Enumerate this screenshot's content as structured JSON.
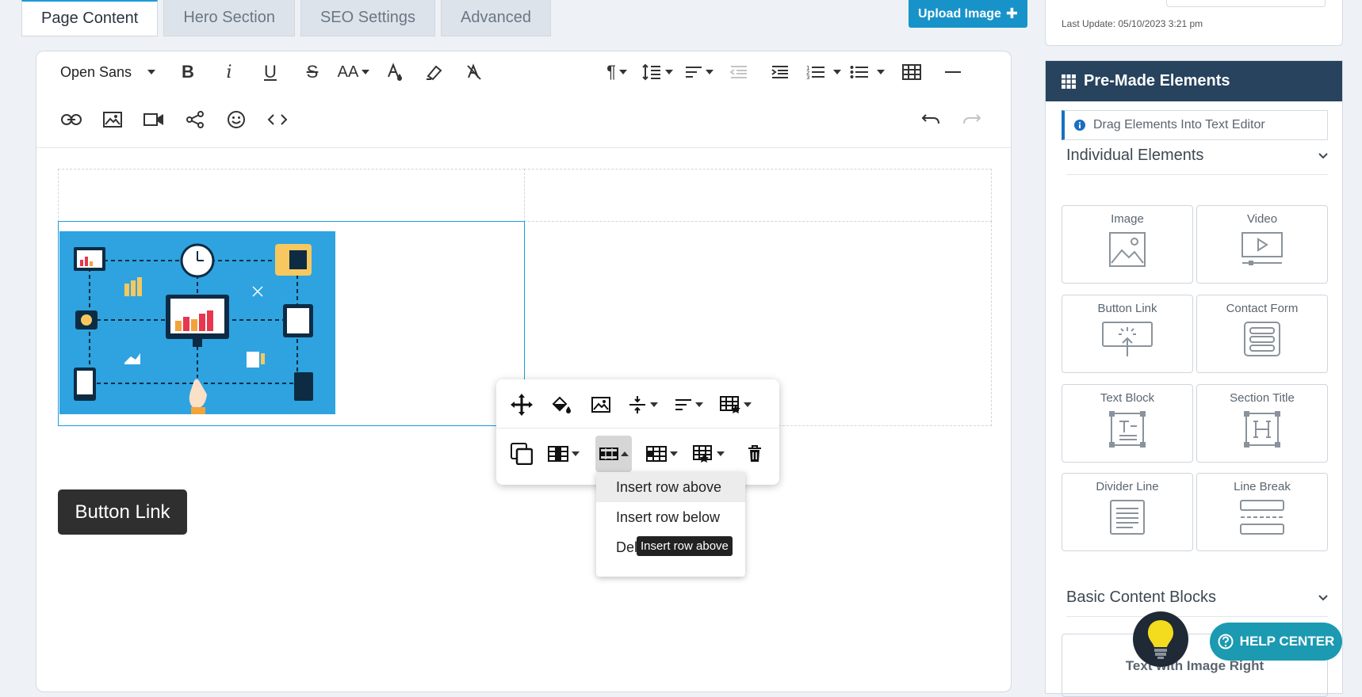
{
  "tabs": [
    {
      "label": "Page Content",
      "active": true
    },
    {
      "label": "Hero Section",
      "active": false
    },
    {
      "label": "SEO Settings",
      "active": false
    },
    {
      "label": "Advanced",
      "active": false
    }
  ],
  "upload_button": {
    "label": "Upload Image",
    "icon": "plus-icon"
  },
  "toolbar": {
    "font_family": "Open Sans",
    "font_size_label": "AA",
    "row1_icons": [
      "bold-icon",
      "italic-icon",
      "underline-icon",
      "strikethrough-icon",
      "font-size-icon",
      "text-color-icon",
      "highlight-icon",
      "clear-format-icon",
      "paragraph-format-icon",
      "line-height-icon",
      "align-icon",
      "outdent-icon",
      "indent-icon",
      "ordered-list-icon",
      "unordered-list-icon",
      "table-icon",
      "horizontal-line-icon"
    ],
    "row2_icons": [
      "link-icon",
      "image-icon",
      "video-icon",
      "share-icon",
      "emoji-icon",
      "code-view-icon",
      "undo-icon",
      "redo-icon"
    ]
  },
  "content": {
    "button_link_label": "Button Link"
  },
  "table_popup": {
    "row1_icons": [
      "move-icon",
      "cell-background-icon",
      "insert-image-icon",
      "vertical-align-icon",
      "horizontal-align-icon",
      "table-style-icon"
    ],
    "row2_icons": [
      "table-header-icon",
      "table-column-icon",
      "table-row-icon",
      "table-cells-icon",
      "cell-style-icon",
      "delete-table-icon"
    ],
    "row_menu": [
      "Insert row above",
      "Insert row below",
      "Delete row"
    ],
    "tooltip": "Insert row above"
  },
  "sidebar": {
    "last_update": "Last Update: 05/10/2023 3:21 pm",
    "premade_title": "Pre-Made Elements",
    "hint": "Drag Elements Into Text Editor",
    "individual_title": "Individual Elements",
    "elements": [
      {
        "label": "Image",
        "icon": "image-placeholder-icon"
      },
      {
        "label": "Video",
        "icon": "video-player-icon"
      },
      {
        "label": "Button Link",
        "icon": "button-click-icon"
      },
      {
        "label": "Contact Form",
        "icon": "form-icon"
      },
      {
        "label": "Text Block",
        "icon": "text-block-icon"
      },
      {
        "label": "Section Title",
        "icon": "heading-icon"
      },
      {
        "label": "Divider Line",
        "icon": "divider-icon"
      },
      {
        "label": "Line Break",
        "icon": "line-break-icon"
      }
    ],
    "basic_title": "Basic Content Blocks",
    "basic_first": "Text with Image Right"
  },
  "help_button": {
    "label": "HELP CENTER"
  },
  "colors": {
    "accent": "#1a9bd7",
    "header": "#27435e",
    "help": "#1b9ab1"
  }
}
